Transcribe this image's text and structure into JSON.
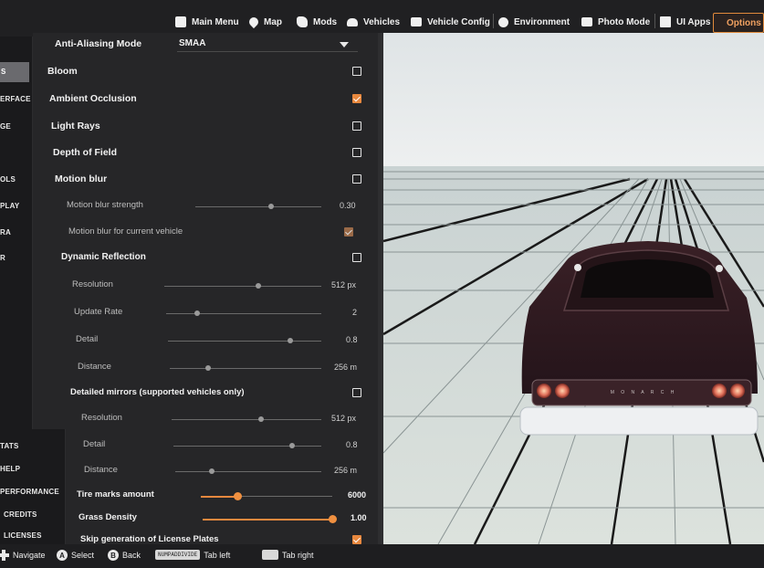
{
  "nav": {
    "items": [
      {
        "label": "Main Menu",
        "icon": "main-menu-icon"
      },
      {
        "label": "Map",
        "icon": "map-icon"
      },
      {
        "label": "Mods",
        "icon": "mods-icon"
      },
      {
        "label": "Vehicles",
        "icon": "vehicles-icon"
      },
      {
        "label": "Vehicle Config",
        "icon": "vehicle-config-icon"
      },
      {
        "label": "Environment",
        "icon": "environment-icon"
      },
      {
        "label": "Photo Mode",
        "icon": "photo-mode-icon"
      },
      {
        "label": "UI Apps",
        "icon": "ui-apps-icon"
      },
      {
        "label": "Options",
        "icon": "options-icon"
      }
    ],
    "active": "Options",
    "accent": "#e8883e"
  },
  "sidebar": {
    "categories": [
      "S",
      "ERFACE",
      "GE",
      "OLS",
      "PLAY",
      "RA",
      "R"
    ],
    "bottom_items": [
      "TATS",
      "HELP",
      "PERFORMANCE",
      "CREDITS",
      "LICENSES"
    ]
  },
  "settings": {
    "anti_aliasing": {
      "label": "Anti-Aliasing Mode",
      "value": "SMAA"
    },
    "bloom": {
      "label": "Bloom",
      "checked": false
    },
    "ambient_occlusion": {
      "label": "Ambient Occlusion",
      "checked": true
    },
    "light_rays": {
      "label": "Light Rays",
      "checked": false
    },
    "depth_of_field": {
      "label": "Depth of Field",
      "checked": false
    },
    "motion_blur": {
      "label": "Motion blur",
      "checked": false
    },
    "motion_blur_strength": {
      "label": "Motion blur strength",
      "value": "0.30",
      "fraction": 0.6
    },
    "motion_blur_vehicle": {
      "label": "Motion blur for current vehicle",
      "checked": true
    },
    "dynamic_reflection": {
      "label": "Dynamic Reflection",
      "checked": false
    },
    "dr_resolution": {
      "label": "Resolution",
      "value": "512 px",
      "fraction": 0.6
    },
    "dr_update_rate": {
      "label": "Update Rate",
      "value": "2",
      "fraction": 0.2
    },
    "dr_detail": {
      "label": "Detail",
      "value": "0.8",
      "fraction": 0.8
    },
    "dr_distance": {
      "label": "Distance",
      "value": "256 m",
      "fraction": 0.25
    },
    "detailed_mirrors": {
      "label": "Detailed mirrors (supported vehicles only)",
      "checked": false
    },
    "dm_resolution": {
      "label": "Resolution",
      "value": "512 px",
      "fraction": 0.6
    },
    "dm_detail": {
      "label": "Detail",
      "value": "0.8",
      "fraction": 0.8
    },
    "dm_distance": {
      "label": "Distance",
      "value": "256 m",
      "fraction": 0.25
    },
    "tire_marks": {
      "label": "Tire marks amount",
      "value": "6000",
      "fraction": 0.28
    },
    "grass_density": {
      "label": "Grass Density",
      "value": "1.00",
      "fraction": 1.0
    },
    "skip_license_plates": {
      "label": "Skip generation of License Plates",
      "checked": true
    }
  },
  "hints": {
    "navigate": "Navigate",
    "select_btn": "A",
    "select": "Select",
    "back_btn": "B",
    "back": "Back",
    "tab_left_key": "NUMPADDIVIDE",
    "tab_left": "Tab left",
    "tab_right": "Tab right"
  },
  "car": {
    "plate_letters": "M O N A R C H"
  }
}
